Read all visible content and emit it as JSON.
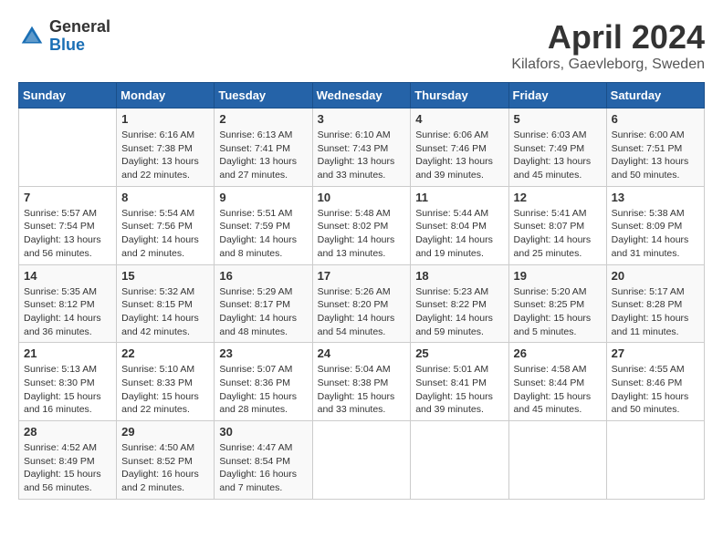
{
  "header": {
    "logo_general": "General",
    "logo_blue": "Blue",
    "month": "April 2024",
    "location": "Kilafors, Gaevleborg, Sweden"
  },
  "weekdays": [
    "Sunday",
    "Monday",
    "Tuesday",
    "Wednesday",
    "Thursday",
    "Friday",
    "Saturday"
  ],
  "weeks": [
    [
      {
        "day": "",
        "info": ""
      },
      {
        "day": "1",
        "info": "Sunrise: 6:16 AM\nSunset: 7:38 PM\nDaylight: 13 hours\nand 22 minutes."
      },
      {
        "day": "2",
        "info": "Sunrise: 6:13 AM\nSunset: 7:41 PM\nDaylight: 13 hours\nand 27 minutes."
      },
      {
        "day": "3",
        "info": "Sunrise: 6:10 AM\nSunset: 7:43 PM\nDaylight: 13 hours\nand 33 minutes."
      },
      {
        "day": "4",
        "info": "Sunrise: 6:06 AM\nSunset: 7:46 PM\nDaylight: 13 hours\nand 39 minutes."
      },
      {
        "day": "5",
        "info": "Sunrise: 6:03 AM\nSunset: 7:49 PM\nDaylight: 13 hours\nand 45 minutes."
      },
      {
        "day": "6",
        "info": "Sunrise: 6:00 AM\nSunset: 7:51 PM\nDaylight: 13 hours\nand 50 minutes."
      }
    ],
    [
      {
        "day": "7",
        "info": "Sunrise: 5:57 AM\nSunset: 7:54 PM\nDaylight: 13 hours\nand 56 minutes."
      },
      {
        "day": "8",
        "info": "Sunrise: 5:54 AM\nSunset: 7:56 PM\nDaylight: 14 hours\nand 2 minutes."
      },
      {
        "day": "9",
        "info": "Sunrise: 5:51 AM\nSunset: 7:59 PM\nDaylight: 14 hours\nand 8 minutes."
      },
      {
        "day": "10",
        "info": "Sunrise: 5:48 AM\nSunset: 8:02 PM\nDaylight: 14 hours\nand 13 minutes."
      },
      {
        "day": "11",
        "info": "Sunrise: 5:44 AM\nSunset: 8:04 PM\nDaylight: 14 hours\nand 19 minutes."
      },
      {
        "day": "12",
        "info": "Sunrise: 5:41 AM\nSunset: 8:07 PM\nDaylight: 14 hours\nand 25 minutes."
      },
      {
        "day": "13",
        "info": "Sunrise: 5:38 AM\nSunset: 8:09 PM\nDaylight: 14 hours\nand 31 minutes."
      }
    ],
    [
      {
        "day": "14",
        "info": "Sunrise: 5:35 AM\nSunset: 8:12 PM\nDaylight: 14 hours\nand 36 minutes."
      },
      {
        "day": "15",
        "info": "Sunrise: 5:32 AM\nSunset: 8:15 PM\nDaylight: 14 hours\nand 42 minutes."
      },
      {
        "day": "16",
        "info": "Sunrise: 5:29 AM\nSunset: 8:17 PM\nDaylight: 14 hours\nand 48 minutes."
      },
      {
        "day": "17",
        "info": "Sunrise: 5:26 AM\nSunset: 8:20 PM\nDaylight: 14 hours\nand 54 minutes."
      },
      {
        "day": "18",
        "info": "Sunrise: 5:23 AM\nSunset: 8:22 PM\nDaylight: 14 hours\nand 59 minutes."
      },
      {
        "day": "19",
        "info": "Sunrise: 5:20 AM\nSunset: 8:25 PM\nDaylight: 15 hours\nand 5 minutes."
      },
      {
        "day": "20",
        "info": "Sunrise: 5:17 AM\nSunset: 8:28 PM\nDaylight: 15 hours\nand 11 minutes."
      }
    ],
    [
      {
        "day": "21",
        "info": "Sunrise: 5:13 AM\nSunset: 8:30 PM\nDaylight: 15 hours\nand 16 minutes."
      },
      {
        "day": "22",
        "info": "Sunrise: 5:10 AM\nSunset: 8:33 PM\nDaylight: 15 hours\nand 22 minutes."
      },
      {
        "day": "23",
        "info": "Sunrise: 5:07 AM\nSunset: 8:36 PM\nDaylight: 15 hours\nand 28 minutes."
      },
      {
        "day": "24",
        "info": "Sunrise: 5:04 AM\nSunset: 8:38 PM\nDaylight: 15 hours\nand 33 minutes."
      },
      {
        "day": "25",
        "info": "Sunrise: 5:01 AM\nSunset: 8:41 PM\nDaylight: 15 hours\nand 39 minutes."
      },
      {
        "day": "26",
        "info": "Sunrise: 4:58 AM\nSunset: 8:44 PM\nDaylight: 15 hours\nand 45 minutes."
      },
      {
        "day": "27",
        "info": "Sunrise: 4:55 AM\nSunset: 8:46 PM\nDaylight: 15 hours\nand 50 minutes."
      }
    ],
    [
      {
        "day": "28",
        "info": "Sunrise: 4:52 AM\nSunset: 8:49 PM\nDaylight: 15 hours\nand 56 minutes."
      },
      {
        "day": "29",
        "info": "Sunrise: 4:50 AM\nSunset: 8:52 PM\nDaylight: 16 hours\nand 2 minutes."
      },
      {
        "day": "30",
        "info": "Sunrise: 4:47 AM\nSunset: 8:54 PM\nDaylight: 16 hours\nand 7 minutes."
      },
      {
        "day": "",
        "info": ""
      },
      {
        "day": "",
        "info": ""
      },
      {
        "day": "",
        "info": ""
      },
      {
        "day": "",
        "info": ""
      }
    ]
  ]
}
